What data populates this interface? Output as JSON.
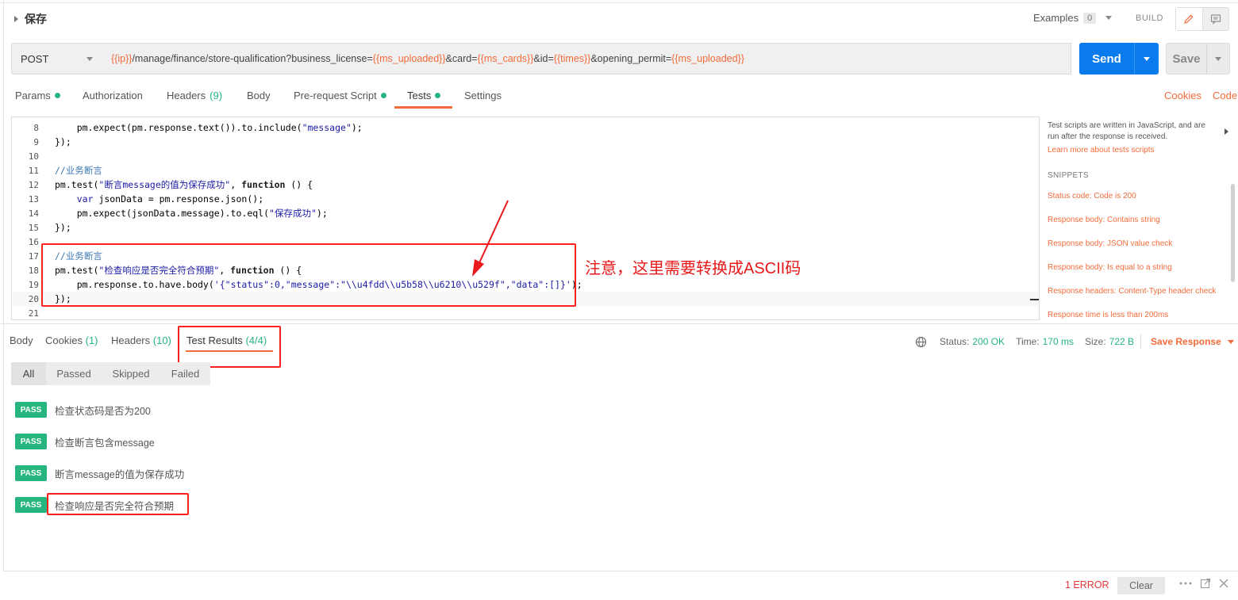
{
  "header": {
    "title": "保存",
    "examples_label": "Examples",
    "examples_count": "0",
    "build_label": "BUILD",
    "edit_icon": "pencil-icon",
    "comment_icon": "comment-icon"
  },
  "request": {
    "method": "POST",
    "url_parts": [
      {
        "text": "{{ip}}",
        "var": true
      },
      {
        "text": "/manage/finance/store-qualification?business_license=",
        "var": false
      },
      {
        "text": "{{ms_uploaded}}",
        "var": true
      },
      {
        "text": "&card=",
        "var": false
      },
      {
        "text": "{{ms_cards}}",
        "var": true
      },
      {
        "text": "&id=",
        "var": false
      },
      {
        "text": "{{times}}",
        "var": true
      },
      {
        "text": "&opening_permit=",
        "var": false
      },
      {
        "text": "{{ms_uploaded}}",
        "var": true
      }
    ],
    "send_label": "Send",
    "save_label": "Save"
  },
  "request_tabs": {
    "params": "Params",
    "authorization": "Authorization",
    "headers": "Headers",
    "headers_count": "(9)",
    "body": "Body",
    "prerequest": "Pre-request Script",
    "tests": "Tests",
    "settings": "Settings",
    "cookies": "Cookies",
    "code": "Code",
    "active": "Tests"
  },
  "editor": {
    "lines": [
      {
        "n": "8",
        "segs": [
          {
            "t": "    pm.expect(pm.response.text()).to.include(",
            "c": ""
          },
          {
            "t": "\"message\"",
            "c": "str"
          },
          {
            "t": ");",
            "c": ""
          }
        ]
      },
      {
        "n": "9",
        "segs": [
          {
            "t": "});",
            "c": ""
          }
        ]
      },
      {
        "n": "10",
        "segs": []
      },
      {
        "n": "11",
        "segs": [
          {
            "t": "//业务断言",
            "c": "cm"
          }
        ]
      },
      {
        "n": "12",
        "segs": [
          {
            "t": "pm.test(",
            "c": ""
          },
          {
            "t": "\"断言message的值为保存成功\"",
            "c": "str"
          },
          {
            "t": ", ",
            "c": ""
          },
          {
            "t": "function",
            "c": "kw"
          },
          {
            "t": " () {",
            "c": ""
          }
        ]
      },
      {
        "n": "13",
        "segs": [
          {
            "t": "    ",
            "c": ""
          },
          {
            "t": "var",
            "c": "str"
          },
          {
            "t": " jsonData = pm.response.json();",
            "c": ""
          }
        ]
      },
      {
        "n": "14",
        "segs": [
          {
            "t": "    pm.expect(jsonData.message).to.eql(",
            "c": ""
          },
          {
            "t": "\"保存成功\"",
            "c": "str"
          },
          {
            "t": ");",
            "c": ""
          }
        ]
      },
      {
        "n": "15",
        "segs": [
          {
            "t": "});",
            "c": ""
          }
        ]
      },
      {
        "n": "16",
        "segs": []
      },
      {
        "n": "17",
        "segs": [
          {
            "t": "//业务断言",
            "c": "cm"
          }
        ]
      },
      {
        "n": "18",
        "segs": [
          {
            "t": "pm.test(",
            "c": ""
          },
          {
            "t": "\"检查响应是否完全符合预期\"",
            "c": "str"
          },
          {
            "t": ", ",
            "c": ""
          },
          {
            "t": "function",
            "c": "kw"
          },
          {
            "t": " () {",
            "c": ""
          }
        ]
      },
      {
        "n": "19",
        "segs": [
          {
            "t": "    pm.response.to.have.body(",
            "c": ""
          },
          {
            "t": "'{\"status\":0,\"message\":\"\\\\u4fdd\\\\u5b58\\\\u6210\\\\u529f\",\"data\":[]}'",
            "c": "str"
          },
          {
            "t": ");",
            "c": ""
          }
        ]
      },
      {
        "n": "20",
        "segs": [
          {
            "t": "});",
            "c": ""
          }
        ]
      },
      {
        "n": "21",
        "segs": []
      }
    ]
  },
  "snippets": {
    "description": "Test scripts are written in JavaScript, and are run after the response is received.",
    "learn_more": "Learn more about tests scripts",
    "heading": "SNIPPETS",
    "items": [
      "Status code: Code is 200",
      "Response body: Contains string",
      "Response body: JSON value check",
      "Response body: Is equal to a string",
      "Response headers: Content-Type header check",
      "Response time is less than 200ms"
    ]
  },
  "annotation": {
    "text": "注意，这里需要转换成ASCII码"
  },
  "response": {
    "tabs": {
      "body": "Body",
      "cookies": "Cookies",
      "cookies_count": "(1)",
      "headers": "Headers",
      "headers_count": "(10)",
      "test_results": "Test Results",
      "test_results_count": "(4/4)"
    },
    "status_label": "Status:",
    "status_value": "200 OK",
    "time_label": "Time:",
    "time_value": "170 ms",
    "size_label": "Size:",
    "size_value": "722 B",
    "save_response": "Save Response",
    "filters": [
      "All",
      "Passed",
      "Skipped",
      "Failed"
    ],
    "results": [
      {
        "badge": "PASS",
        "name": "检查状态码是否为200"
      },
      {
        "badge": "PASS",
        "name": "检查断言包含message"
      },
      {
        "badge": "PASS",
        "name": "断言message的值为保存成功"
      },
      {
        "badge": "PASS",
        "name": "检查响应是否完全符合预期"
      }
    ]
  },
  "footer": {
    "error": "1 ERROR",
    "clear": "Clear"
  },
  "colors": {
    "accent": "#f26b3a",
    "send": "#097bed",
    "pass": "#26b47f",
    "annotation": "#ff1f1f"
  }
}
